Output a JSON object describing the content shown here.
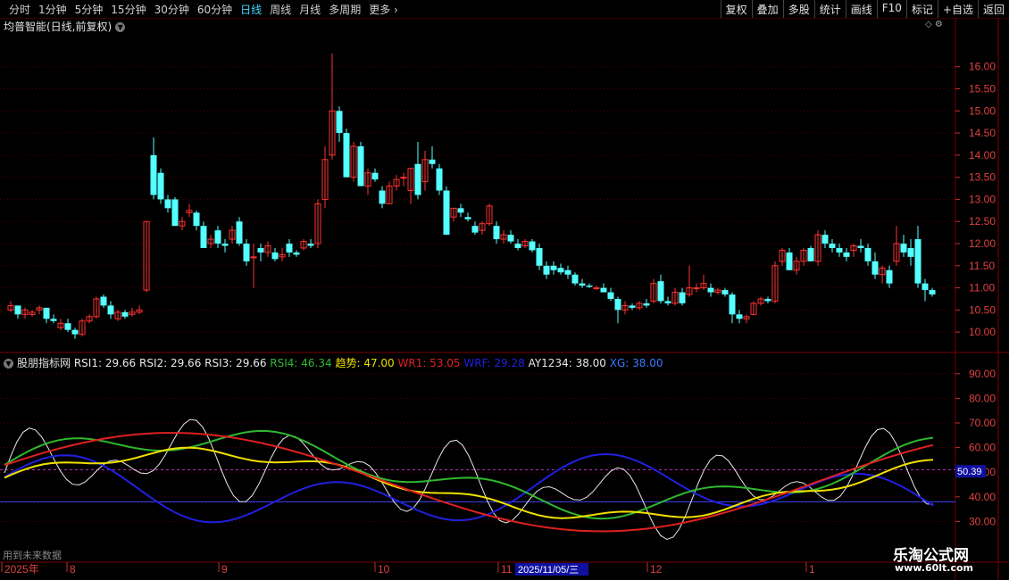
{
  "toolbar": {
    "periods": [
      "分时",
      "1分钟",
      "5分钟",
      "15分钟",
      "30分钟",
      "60分钟",
      "日线",
      "周线",
      "月线",
      "多周期",
      "更多"
    ],
    "active_period": "日线",
    "right_buttons": [
      "复权",
      "叠加",
      "多股",
      "统计",
      "画线",
      "F10",
      "标记",
      "+自选",
      "返回"
    ]
  },
  "main_panel": {
    "title": "均普智能(日线,前复权)",
    "y_ticks": [
      "16.00",
      "15.50",
      "15.00",
      "14.50",
      "14.00",
      "13.50",
      "13.00",
      "12.50",
      "12.00",
      "11.50",
      "11.00",
      "10.50",
      "10.00"
    ]
  },
  "indicator_panel": {
    "name": "股朋指标网",
    "values": [
      {
        "label": "RSI1: 29.66",
        "color": "#e8e8e8"
      },
      {
        "label": "RSI2: 29.66",
        "color": "#e8e8e8"
      },
      {
        "label": "RSI3: 29.66",
        "color": "#e8e8e8"
      },
      {
        "label": "RSI4: 46.34",
        "color": "#2fb82f"
      },
      {
        "label": "趋势: 47.00",
        "color": "#f0e000"
      },
      {
        "label": "WR1: 53.05",
        "color": "#e02020"
      },
      {
        "label": "WRF: 29.28",
        "color": "#2020e0"
      },
      {
        "label": "AY1234: 38.00",
        "color": "#e8e8e8"
      },
      {
        "label": "XG: 38.00",
        "color": "#3a7aff"
      }
    ],
    "y_ticks": [
      "90.00",
      "80.00",
      "70.00",
      "60.00",
      "50.00",
      "40.00",
      "30.00"
    ],
    "current_value": "50.39",
    "future_label": "用到未来数据"
  },
  "time_axis": {
    "labels": [
      {
        "text": "2025年"
      },
      {
        "text": "8"
      },
      {
        "text": "9"
      },
      {
        "text": "10"
      },
      {
        "text": "11"
      },
      {
        "text": "12"
      },
      {
        "text": "1"
      }
    ],
    "cursor_date": "2025/11/05/三"
  },
  "watermark": {
    "line1": "乐淘公式网",
    "line2": "www.60lt.com"
  },
  "chart_data": {
    "type": "candlestick",
    "title": "均普智能(日线,前复权)",
    "ylim": [
      9.8,
      16.4
    ],
    "candles": [
      [
        10.5,
        10.7,
        10.45,
        10.6
      ],
      [
        10.6,
        10.6,
        10.3,
        10.4
      ],
      [
        10.4,
        10.55,
        10.3,
        10.5
      ],
      [
        10.4,
        10.5,
        10.35,
        10.45
      ],
      [
        10.5,
        10.6,
        10.4,
        10.55
      ],
      [
        10.55,
        10.55,
        10.2,
        10.3
      ],
      [
        10.3,
        10.4,
        10.2,
        10.25
      ],
      [
        10.1,
        10.3,
        10.05,
        10.2
      ],
      [
        10.2,
        10.3,
        10.0,
        10.05
      ],
      [
        10.05,
        10.1,
        9.85,
        9.95
      ],
      [
        9.95,
        10.3,
        9.9,
        10.25
      ],
      [
        10.25,
        10.4,
        10.2,
        10.35
      ],
      [
        10.35,
        10.8,
        10.3,
        10.75
      ],
      [
        10.8,
        10.85,
        10.55,
        10.6
      ],
      [
        10.6,
        10.7,
        10.3,
        10.4
      ],
      [
        10.3,
        10.5,
        10.25,
        10.45
      ],
      [
        10.45,
        10.5,
        10.3,
        10.35
      ],
      [
        10.4,
        10.55,
        10.35,
        10.45
      ],
      [
        10.45,
        10.6,
        10.4,
        10.5
      ],
      [
        10.95,
        12.5,
        10.9,
        12.5
      ],
      [
        14.0,
        14.4,
        13.0,
        13.1
      ],
      [
        13.6,
        13.7,
        12.9,
        13.0
      ],
      [
        13.0,
        13.1,
        12.7,
        12.8
      ],
      [
        13.0,
        13.05,
        12.4,
        12.4
      ],
      [
        12.4,
        12.6,
        12.3,
        12.5
      ],
      [
        12.7,
        12.9,
        12.6,
        12.75
      ],
      [
        12.7,
        12.75,
        12.3,
        12.4
      ],
      [
        12.4,
        12.5,
        11.9,
        11.9
      ],
      [
        12.0,
        12.2,
        11.9,
        12.1
      ],
      [
        12.3,
        12.4,
        11.9,
        12.0
      ],
      [
        12.0,
        12.1,
        11.8,
        11.95
      ],
      [
        12.1,
        12.4,
        12.0,
        12.3
      ],
      [
        12.5,
        12.6,
        11.95,
        12.0
      ],
      [
        12.0,
        12.1,
        11.5,
        11.6
      ],
      [
        11.7,
        12.0,
        11.0,
        11.7
      ],
      [
        11.9,
        12.0,
        11.6,
        11.8
      ],
      [
        11.8,
        12.05,
        11.7,
        11.95
      ],
      [
        11.8,
        11.9,
        11.6,
        11.65
      ],
      [
        11.7,
        11.9,
        11.6,
        11.75
      ],
      [
        12.0,
        12.1,
        11.7,
        11.8
      ],
      [
        11.8,
        11.85,
        11.7,
        11.75
      ],
      [
        11.9,
        12.1,
        11.85,
        12.05
      ],
      [
        12.0,
        12.1,
        11.9,
        11.95
      ],
      [
        12.0,
        13.0,
        11.9,
        12.9
      ],
      [
        13.0,
        14.2,
        12.8,
        13.9
      ],
      [
        14.0,
        16.3,
        13.9,
        15.0
      ],
      [
        15.0,
        15.1,
        14.3,
        14.5
      ],
      [
        14.5,
        14.6,
        13.5,
        13.5
      ],
      [
        13.5,
        14.3,
        13.4,
        14.2
      ],
      [
        14.2,
        14.3,
        13.3,
        13.3
      ],
      [
        13.3,
        13.7,
        13.1,
        13.6
      ],
      [
        13.6,
        13.7,
        13.4,
        13.45
      ],
      [
        13.2,
        13.3,
        12.8,
        12.9
      ],
      [
        12.9,
        13.4,
        12.9,
        13.3
      ],
      [
        13.3,
        13.55,
        13.2,
        13.45
      ],
      [
        13.5,
        13.6,
        13.3,
        13.5
      ],
      [
        13.2,
        13.7,
        12.9,
        13.7
      ],
      [
        13.8,
        14.3,
        13.0,
        13.1
      ],
      [
        13.4,
        14.1,
        13.2,
        13.9
      ],
      [
        13.9,
        14.2,
        13.7,
        13.8
      ],
      [
        13.7,
        13.8,
        13.1,
        13.2
      ],
      [
        13.2,
        13.3,
        12.2,
        12.2
      ],
      [
        12.6,
        12.8,
        12.5,
        12.8
      ],
      [
        12.8,
        12.9,
        12.6,
        12.7
      ],
      [
        12.6,
        12.7,
        12.5,
        12.55
      ],
      [
        12.4,
        12.5,
        12.2,
        12.25
      ],
      [
        12.3,
        12.5,
        12.2,
        12.45
      ],
      [
        12.45,
        12.9,
        12.4,
        12.85
      ],
      [
        12.4,
        12.5,
        12.0,
        12.1
      ],
      [
        12.1,
        12.3,
        12.0,
        12.2
      ],
      [
        12.2,
        12.3,
        12.0,
        12.05
      ],
      [
        12.0,
        12.1,
        11.85,
        11.9
      ],
      [
        11.95,
        12.1,
        11.9,
        12.05
      ],
      [
        12.05,
        12.1,
        11.8,
        11.85
      ],
      [
        11.9,
        12.0,
        11.4,
        11.5
      ],
      [
        11.5,
        11.6,
        11.2,
        11.3
      ],
      [
        11.5,
        11.6,
        11.3,
        11.4
      ],
      [
        11.45,
        11.55,
        11.3,
        11.35
      ],
      [
        11.4,
        11.5,
        11.2,
        11.3
      ],
      [
        11.3,
        11.35,
        11.05,
        11.1
      ],
      [
        11.1,
        11.2,
        11.0,
        11.05
      ],
      [
        11.05,
        11.1,
        11.0,
        11.02
      ],
      [
        11.0,
        11.05,
        10.95,
        11.0
      ],
      [
        11.0,
        11.1,
        10.9,
        10.9
      ],
      [
        10.9,
        11.0,
        10.7,
        10.75
      ],
      [
        10.75,
        10.8,
        10.2,
        10.5
      ],
      [
        10.5,
        10.7,
        10.4,
        10.6
      ],
      [
        10.6,
        10.65,
        10.5,
        10.55
      ],
      [
        10.55,
        10.7,
        10.5,
        10.65
      ],
      [
        10.65,
        10.75,
        10.55,
        10.6
      ],
      [
        10.7,
        11.2,
        10.65,
        11.1
      ],
      [
        11.15,
        11.3,
        10.65,
        10.7
      ],
      [
        10.7,
        10.8,
        10.6,
        10.65
      ],
      [
        10.65,
        11.0,
        10.6,
        10.9
      ],
      [
        10.9,
        11.0,
        10.6,
        10.65
      ],
      [
        10.85,
        11.5,
        10.8,
        11.0
      ],
      [
        11.0,
        11.1,
        10.9,
        11.0
      ],
      [
        11.0,
        11.3,
        10.95,
        11.1
      ],
      [
        11.0,
        11.1,
        10.8,
        10.9
      ],
      [
        10.9,
        11.0,
        10.85,
        10.95
      ],
      [
        10.95,
        11.0,
        10.8,
        10.85
      ],
      [
        10.85,
        10.9,
        10.2,
        10.4
      ],
      [
        10.4,
        10.5,
        10.2,
        10.3
      ],
      [
        10.3,
        10.4,
        10.2,
        10.35
      ],
      [
        10.4,
        10.7,
        10.4,
        10.65
      ],
      [
        10.65,
        10.8,
        10.6,
        10.75
      ],
      [
        10.75,
        10.8,
        10.65,
        10.7
      ],
      [
        10.7,
        11.6,
        10.65,
        11.5
      ],
      [
        11.6,
        11.9,
        11.5,
        11.85
      ],
      [
        11.8,
        11.9,
        11.4,
        11.4
      ],
      [
        11.4,
        11.7,
        11.3,
        11.6
      ],
      [
        11.6,
        11.9,
        11.5,
        11.85
      ],
      [
        11.9,
        11.95,
        11.6,
        11.6
      ],
      [
        11.6,
        12.3,
        11.5,
        12.2
      ],
      [
        12.2,
        12.3,
        11.9,
        12.0
      ],
      [
        12.0,
        12.1,
        11.8,
        11.9
      ],
      [
        11.9,
        12.0,
        11.7,
        11.8
      ],
      [
        11.8,
        11.9,
        11.6,
        11.7
      ],
      [
        11.85,
        12.0,
        11.7,
        11.95
      ],
      [
        11.95,
        12.1,
        11.8,
        11.9
      ],
      [
        11.9,
        12.0,
        11.5,
        11.6
      ],
      [
        11.6,
        11.8,
        11.2,
        11.3
      ],
      [
        11.3,
        11.5,
        11.1,
        11.45
      ],
      [
        11.4,
        11.5,
        11.0,
        11.1
      ],
      [
        11.6,
        12.4,
        11.5,
        12.0
      ],
      [
        12.0,
        12.2,
        11.7,
        11.8
      ],
      [
        11.9,
        12.1,
        11.5,
        11.7
      ],
      [
        12.1,
        12.4,
        11.0,
        11.1
      ],
      [
        11.1,
        11.2,
        10.7,
        10.95
      ],
      [
        10.95,
        11.0,
        10.8,
        10.85
      ]
    ]
  }
}
